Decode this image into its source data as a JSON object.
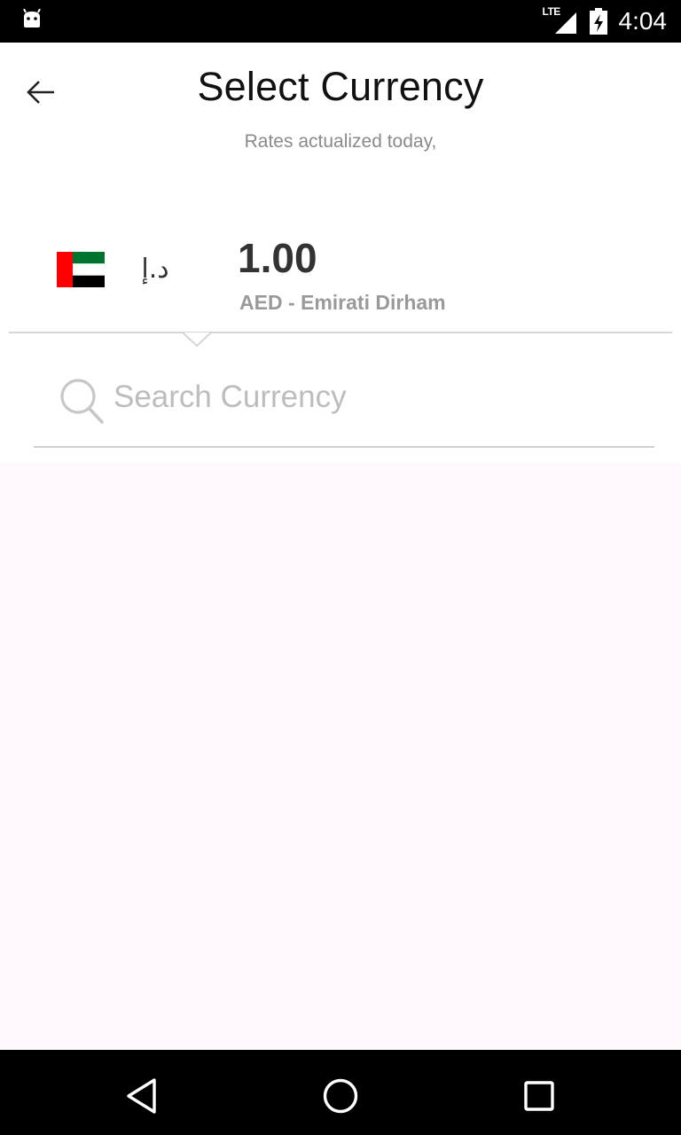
{
  "status_bar": {
    "time": "4:04",
    "network_label": "LTE",
    "icons": [
      "android-notification-icon",
      "lte-signal-icon",
      "battery-charging-icon"
    ]
  },
  "header": {
    "back_icon": "arrow-left-icon",
    "title": "Select Currency",
    "subtitle": "Rates actualized today,"
  },
  "selected_currency": {
    "flag_icon": "uae-flag-icon",
    "flag_colors": {
      "red": "#ff0000",
      "green": "#00732f",
      "white": "#ffffff",
      "black": "#000000"
    },
    "symbol": "د.إ",
    "amount": "1.00",
    "name": "AED - Emirati Dirham"
  },
  "search": {
    "icon": "search-icon",
    "placeholder": "Search Currency",
    "value": ""
  },
  "results": {
    "background": "#fdf9fd"
  },
  "nav_bar": {
    "icons": [
      "nav-back-icon",
      "nav-home-icon",
      "nav-recents-icon"
    ]
  }
}
